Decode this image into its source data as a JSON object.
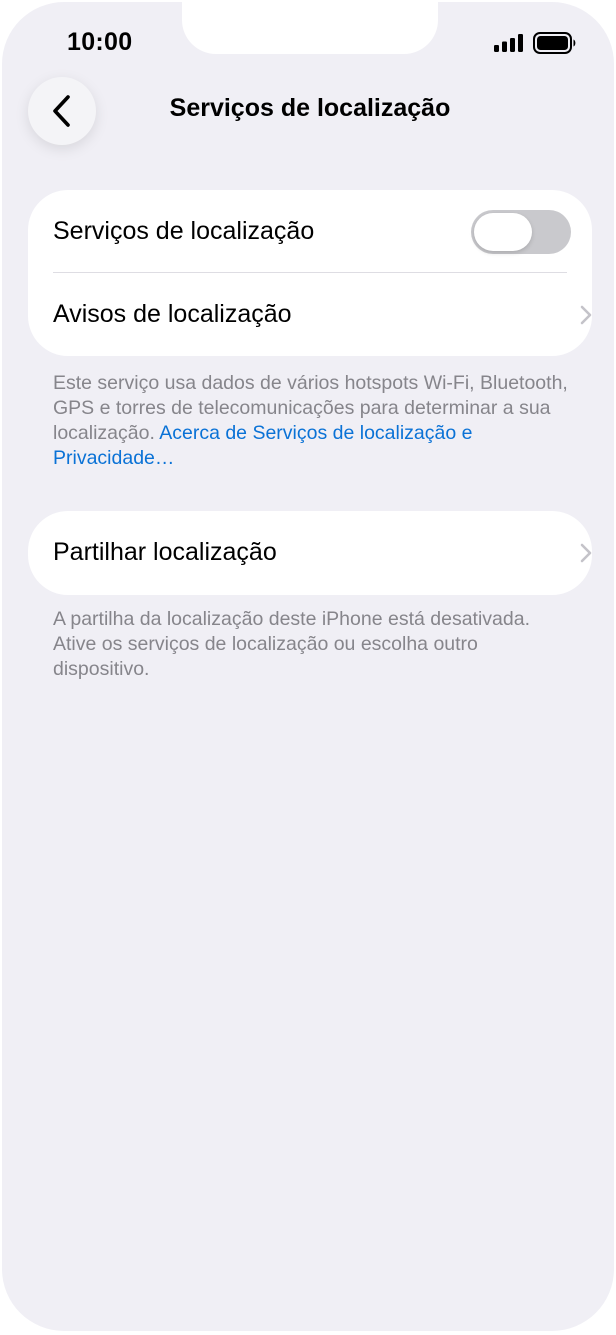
{
  "status_bar": {
    "time": "10:00",
    "signal_icon": "cellular-signal-icon",
    "battery_icon": "battery-icon"
  },
  "nav": {
    "back_icon": "chevron-left-icon",
    "title": "Serviços de localização"
  },
  "section1": {
    "rows": [
      {
        "label": "Serviços de localização",
        "control": "toggle",
        "toggle_on": false
      },
      {
        "label": "Avisos de localização",
        "control": "chevron-right-icon"
      }
    ],
    "footer_text": "Este serviço usa dados de vários hotspots Wi-Fi, Bluetooth, GPS e torres de telecomunicações para determinar a sua localização.",
    "footer_link": "Acerca de Serviços de localização e Privacidade…"
  },
  "section2": {
    "rows": [
      {
        "label": "Partilhar localização",
        "control": "chevron-right-icon"
      }
    ],
    "footer_text": "A partilha da localização deste iPhone está desativada. Ative os serviços de localização ou escolha outro dispositivo."
  },
  "colors": {
    "background": "#f0eff5",
    "card": "#ffffff",
    "link": "#0a72d6",
    "secondary_text": "#86858b",
    "toggle_off": "#c9c9cd"
  }
}
